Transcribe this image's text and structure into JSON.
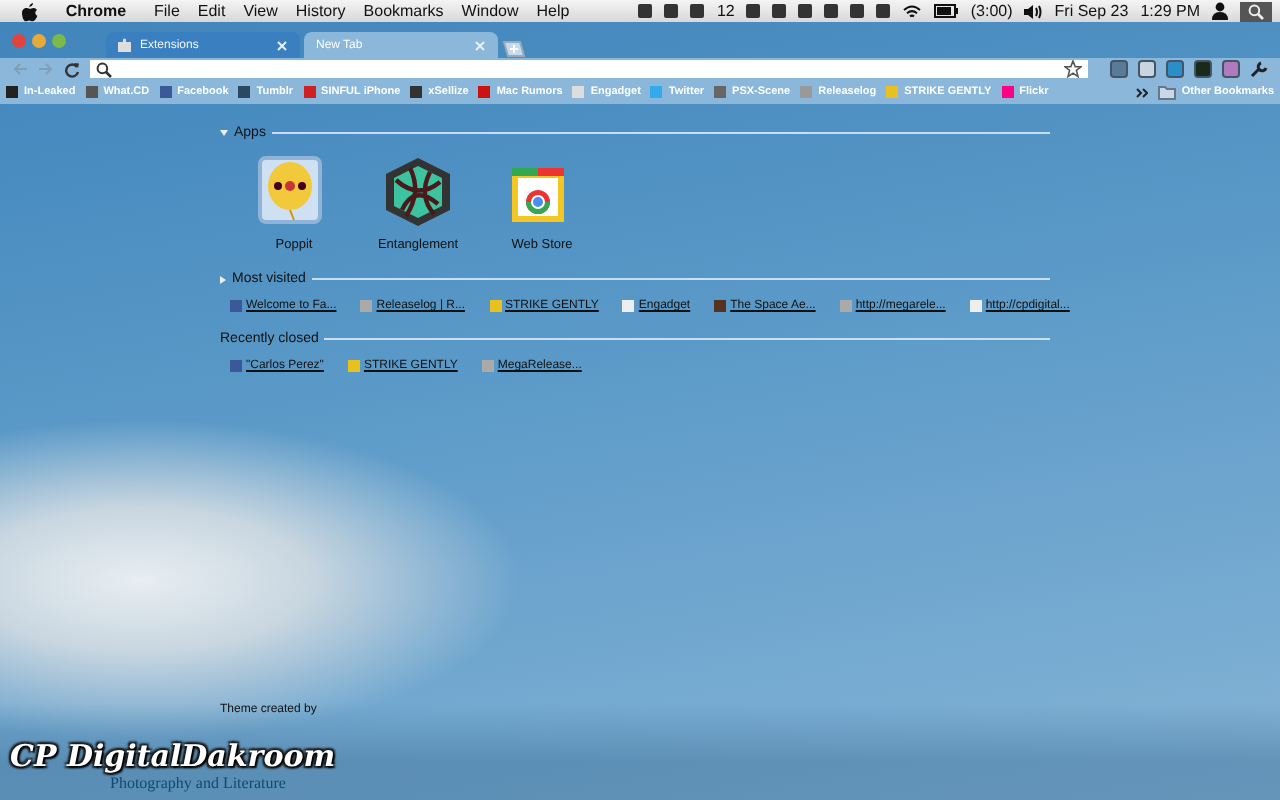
{
  "menu_bar": {
    "items": [
      "Chrome",
      "File",
      "Edit",
      "View",
      "History",
      "Bookmarks",
      "Window",
      "Help"
    ],
    "status": [
      "12",
      "(3:00)",
      "Fri Sep 23",
      "1:29 PM"
    ]
  },
  "tabs": [
    {
      "label": "Extensions",
      "selected": false
    },
    {
      "label": "New Tab",
      "selected": true
    }
  ],
  "bookmarks": [
    {
      "label": "In-Leaked",
      "color": "#222222"
    },
    {
      "label": "What.CD",
      "color": "#555555"
    },
    {
      "label": "Facebook",
      "color": "#3b5998"
    },
    {
      "label": "Tumblr",
      "color": "#2c4762"
    },
    {
      "label": "SINFUL iPhone",
      "color": "#cc2222"
    },
    {
      "label": "xSellize",
      "color": "#333333"
    },
    {
      "label": "Mac Rumors",
      "color": "#cc1111"
    },
    {
      "label": "Engadget",
      "color": "#dddddd"
    },
    {
      "label": "Twitter",
      "color": "#33aaee"
    },
    {
      "label": "PSX-Scene",
      "color": "#666666"
    },
    {
      "label": "Releaselog",
      "color": "#999999"
    },
    {
      "label": "STRIKE GENTLY",
      "color": "#e8c020"
    },
    {
      "label": "Flickr",
      "color": "#ff0084"
    }
  ],
  "other_bookmarks": "Other Bookmarks",
  "sections": [
    {
      "title": "Apps",
      "expanded": true,
      "apps": [
        {
          "label": "Poppit",
          "kind": "balloon"
        },
        {
          "label": "Entanglement",
          "kind": "hexagon"
        },
        {
          "label": "Web Store",
          "kind": "store"
        }
      ]
    },
    {
      "title": "Most visited",
      "expanded": false,
      "links": [
        {
          "label": "Welcome to Fa...",
          "color": "#3b5998"
        },
        {
          "label": "Releaselog | R...",
          "color": "#aaaaaa"
        },
        {
          "label": "STRIKE GENTLY",
          "color": "#e8c020"
        },
        {
          "label": "Engadget",
          "color": "#eeeeee"
        },
        {
          "label": "The Space Ae...",
          "color": "#553322"
        },
        {
          "label": "http://megarele...",
          "color": "#aaaaaa"
        },
        {
          "label": "http://cpdigital...",
          "color": "#eeeeee"
        }
      ]
    },
    {
      "title": "Recently closed",
      "links": [
        {
          "label": "\"Carlos Perez\"",
          "color": "#3b5998"
        },
        {
          "label": "STRIKE GENTLY",
          "color": "#e8c020"
        },
        {
          "label": "MegaRelease...",
          "color": "#aaaaaa"
        }
      ]
    }
  ],
  "theme_credit": {
    "caption": "Theme created by",
    "logo": "CP DigitalDakroom",
    "tagline": "Photography and Literature"
  }
}
